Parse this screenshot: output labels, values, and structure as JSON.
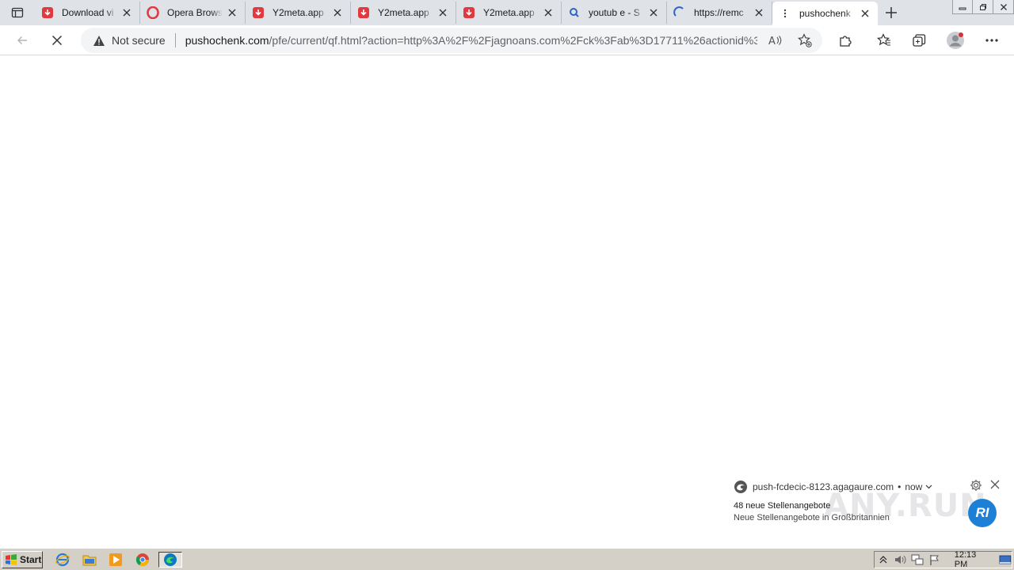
{
  "browser": {
    "tabs": [
      {
        "title": "Download vi",
        "favicon": "download-favicon",
        "color": "#e2383f"
      },
      {
        "title": "Opera Brows",
        "favicon": "opera-favicon",
        "color": "#e2383f"
      },
      {
        "title": "Y2meta.app",
        "favicon": "download-favicon",
        "color": "#e2383f"
      },
      {
        "title": "Y2meta.app",
        "favicon": "download-favicon",
        "color": "#e2383f"
      },
      {
        "title": "Y2meta.app",
        "favicon": "download-favicon",
        "color": "#e2383f"
      },
      {
        "title": "youtub e - S",
        "favicon": "search-favicon",
        "color": "#2b63c6"
      },
      {
        "title": "https://remc",
        "favicon": "loading-spinner-favicon",
        "color": "#2b63c6"
      },
      {
        "title": "pushochenk",
        "favicon": "loading-dots-favicon",
        "color": "#444444",
        "active": true
      }
    ],
    "address": {
      "security_label": "Not secure",
      "host": "pushochenk.com",
      "path": "/pfe/current/qf.html?action=http%3A%2F%2Fjagnoans.com%2Fck%3Fab%3D17711%26actionid%3..."
    }
  },
  "notification": {
    "source": "push-fcdecic-8123.agagaure.com",
    "separator": "•",
    "time": "now",
    "title": "48 neue Stellenangebote",
    "body": "Neue Stellenangebote in Großbritannien",
    "watermark_text": "ANY.RUN",
    "watermark_badge": "RI"
  },
  "taskbar": {
    "start_label": "Start",
    "clock": "12:13 PM"
  },
  "colors": {
    "accent": "#1e7fd6",
    "tab_strip": "#dfe3e8",
    "taskbar": "#d4d0c8"
  }
}
